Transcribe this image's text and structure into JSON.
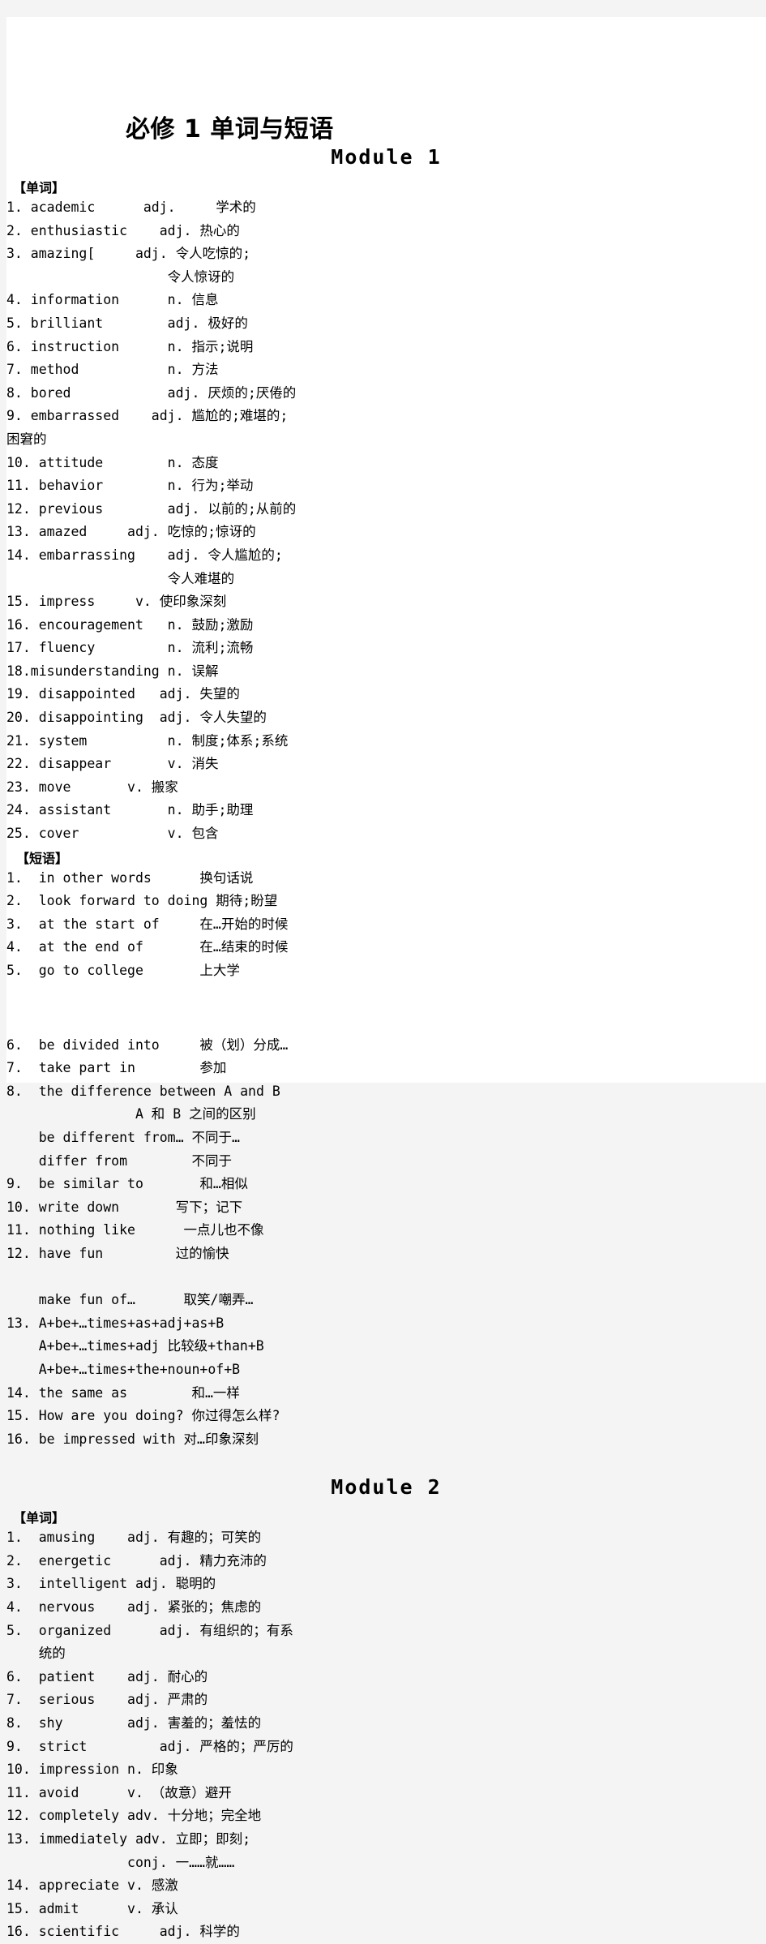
{
  "document": {
    "title": "必修 1 单词与短语",
    "page_background": "#ffffff",
    "outer_background": "#f4f4f4",
    "text_color": "#111111"
  },
  "labels": {
    "words": "【单词】",
    "phrases": "【短语】"
  },
  "modules": {
    "module1_heading": "Module 1",
    "module2_heading": "Module 2"
  },
  "left_column": {
    "module1_words": [
      "1. academic      adj.     学术的",
      "2. enthusiastic    adj. 热心的",
      "3. amazing[     adj. 令人吃惊的;",
      "                    令人惊讶的",
      "4. information      n. 信息",
      "5. brilliant        adj. 极好的",
      "6. instruction      n. 指示;说明",
      "7. method           n. 方法",
      "8. bored            adj. 厌烦的;厌倦的",
      "9. embarrassed    adj. 尴尬的;难堪的;",
      "困窘的",
      "10. attitude        n. 态度",
      "11. behavior        n. 行为;举动",
      "12. previous        adj. 以前的;从前的",
      "13. amazed     adj. 吃惊的;惊讶的",
      "14. embarrassing    adj. 令人尴尬的;",
      "                    令人难堪的",
      "15. impress     v. 使印象深刻",
      "16. encouragement   n. 鼓励;激励",
      "17. fluency         n. 流利;流畅",
      "18.misunderstanding n. 误解",
      "19. disappointed   adj. 失望的",
      "20. disappointing  adj. 令人失望的",
      "21. system          n. 制度;体系;系统",
      "22. disappear       v. 消失",
      "23. move       v. 搬家",
      "24. assistant       n. 助手;助理",
      "25. cover           v. 包含"
    ],
    "module1_phrases": [
      "1.  in other words      换句话说",
      "2.  look forward to doing 期待;盼望",
      "3.  at the start of     在…开始的时候",
      "4.  at the end of       在…结束的时候",
      "5.  go to college       上大学"
    ]
  },
  "right_column": {
    "module1_phrases_cont": [
      "6.  be divided into     被（划）分成…",
      "7.  take part in        参加",
      "8.  the difference between A and B",
      "                A 和 B 之间的区别",
      "    be different from… 不同于…",
      "    differ from        不同于",
      "9.  be similar to       和…相似",
      "10. write down       写下；记下",
      "11. nothing like      一点儿也不像",
      "12. have fun         过的愉快",
      "",
      "    make fun of…      取笑/嘲弄…",
      "13. A+be+…times+as+adj+as+B",
      "    A+be+…times+adj 比较级+than+B",
      "    A+be+…times+the+noun+of+B",
      "14. the same as        和…一样",
      "15. How are you doing? 你过得怎么样?",
      "16. be impressed with 对…印象深刻"
    ],
    "module2_words": [
      "1.  amusing    adj. 有趣的；可笑的",
      "2.  energetic      adj. 精力充沛的",
      "3.  intelligent adj. 聪明的",
      "4.  nervous    adj. 紧张的；焦虑的",
      "5.  organized      adj. 有组织的；有系",
      "    统的",
      "6.  patient    adj. 耐心的",
      "7.  serious    adj. 严肃的",
      "8.  shy        adj. 害羞的；羞怯的",
      "9.  strict         adj. 严格的；严厉的",
      "10. impression n. 印象",
      "11. avoid      v. （故意）避开",
      "12. completely adv. 十分地；完全地",
      "13. immediately adv. 立即；即刻;",
      "               conj. 一……就……",
      "14. appreciate v. 感激",
      "15. admit      v. 承认",
      "16. scientific     adj. 科学的"
    ]
  }
}
